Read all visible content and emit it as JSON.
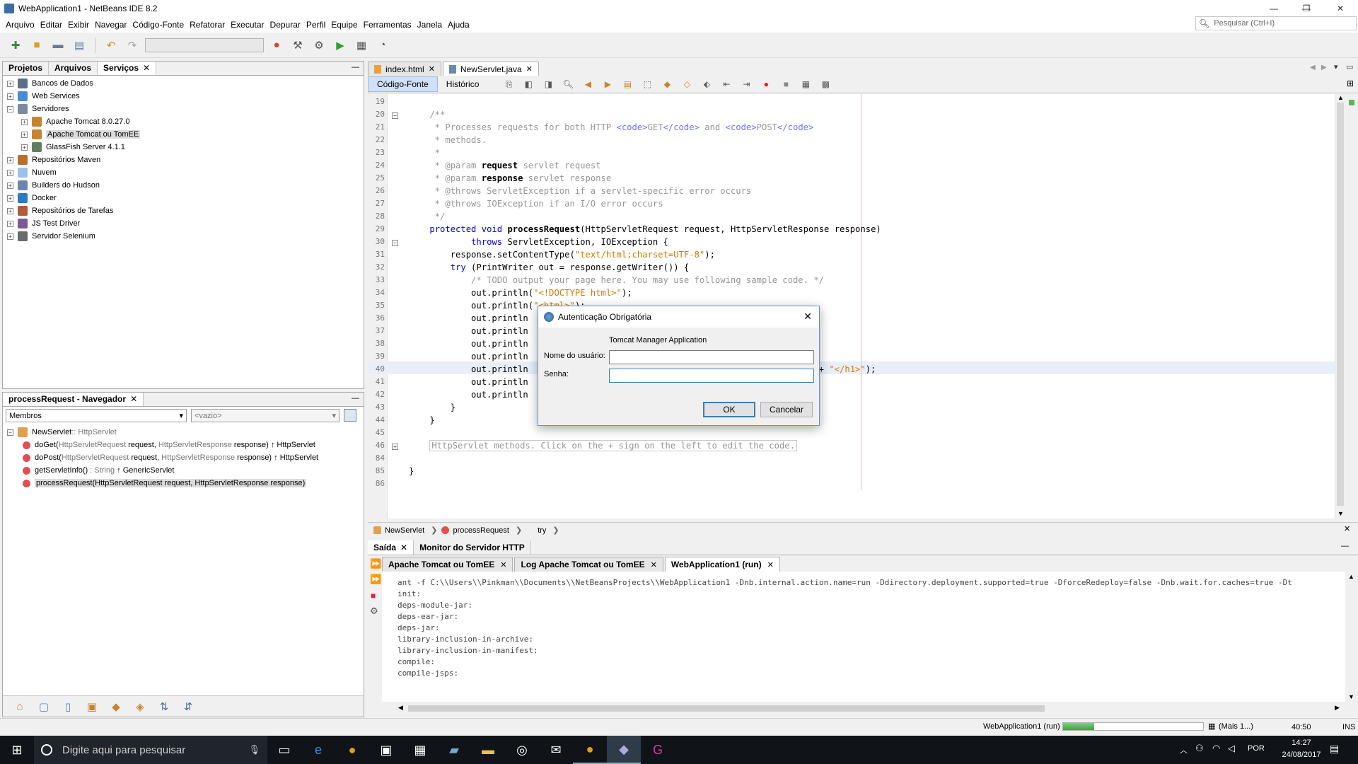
{
  "window": {
    "title": "WebApplication1 - NetBeans IDE 8.2",
    "minimize": "—",
    "maximize": "❐",
    "close": "✕"
  },
  "menu": [
    "Arquivo",
    "Editar",
    "Exibir",
    "Navegar",
    "Código-Fonte",
    "Refatorar",
    "Executar",
    "Depurar",
    "Perfil",
    "Equipe",
    "Ferramentas",
    "Janela",
    "Ajuda"
  ],
  "search": {
    "placeholder": "Pesquisar (Ctrl+I)"
  },
  "left_top": {
    "tabs": [
      "Projetos",
      "Arquivos",
      "Serviços"
    ],
    "active_tab": "Serviços",
    "minimize_label": "—",
    "tree": [
      {
        "label": "Bancos de Dados",
        "level": 0,
        "color": "#5a6e8c"
      },
      {
        "label": "Web Services",
        "level": 0,
        "color": "#4b8bd4"
      },
      {
        "label": "Servidores",
        "level": 0,
        "color": "#7a8aa0",
        "expanded": true
      },
      {
        "label": "Apache Tomcat 8.0.27.0",
        "level": 1,
        "color": "#c8842c"
      },
      {
        "label": "Apache Tomcat ou TomEE",
        "level": 1,
        "color": "#c8842c",
        "selected": true
      },
      {
        "label": "GlassFish Server 4.1.1",
        "level": 1,
        "color": "#5f7f5f"
      },
      {
        "label": "Repositórios Maven",
        "level": 0,
        "color": "#b8702a"
      },
      {
        "label": "Nuvem",
        "level": 0,
        "color": "#9cc2e8"
      },
      {
        "label": "Builders do Hudson",
        "level": 0,
        "color": "#6a86b0"
      },
      {
        "label": "Docker",
        "level": 0,
        "color": "#2e7ac2"
      },
      {
        "label": "Repositórios de Tarefas",
        "level": 0,
        "color": "#b05a3a"
      },
      {
        "label": "JS Test Driver",
        "level": 0,
        "color": "#7a5a9a"
      },
      {
        "label": "Servidor Selenium",
        "level": 0,
        "color": "#6a6a6a"
      }
    ]
  },
  "navigator": {
    "title": "processRequest - Navegador",
    "minimize_label": "—",
    "filter_left": "Membros",
    "filter_right": "<vazio>",
    "class_label": "NewServlet",
    "class_super": " :: HttpServlet",
    "members": [
      {
        "name": "doGet(",
        "params": "HttpServletRequest",
        "rest": " request, ",
        "params2": "HttpServletResponse",
        "rest2": " response) ↑ HttpServlet"
      },
      {
        "name": "doPost(",
        "params": "HttpServletRequest",
        "rest": " request, ",
        "params2": "HttpServletResponse",
        "rest2": " response) ↑ HttpServlet"
      },
      {
        "name": "getServletInfo()",
        "params": " : String",
        "rest": " ↑ GenericServlet",
        "params2": "",
        "rest2": ""
      },
      {
        "name": "processRequest(HttpServletRequest request, HttpServletResponse response)",
        "params": "",
        "rest": "",
        "params2": "",
        "rest2": "",
        "selected": true
      }
    ]
  },
  "editor": {
    "tabs": [
      {
        "label": "index.html",
        "active": false
      },
      {
        "label": "NewServlet.java",
        "active": true
      }
    ],
    "subtabs": [
      "Código-Fonte",
      "Histórico"
    ],
    "lines": [
      {
        "n": "19",
        "html": ""
      },
      {
        "n": "20",
        "html": "<span class=\"cm\">    /**</span>"
      },
      {
        "n": "21",
        "html": "<span class=\"cm\">     * Processes requests for both HTTP </span><span class=\"tag\">&lt;code&gt;</span><span class=\"cm\">GET</span><span class=\"tag\">&lt;/code&gt;</span><span class=\"cm\"> and </span><span class=\"tag\">&lt;code&gt;</span><span class=\"cm\">POST</span><span class=\"tag\">&lt;/code&gt;</span>"
      },
      {
        "n": "22",
        "html": "<span class=\"cm\">     * methods.</span>"
      },
      {
        "n": "23",
        "html": "<span class=\"cm\">     *</span>"
      },
      {
        "n": "24",
        "html": "<span class=\"cm\">     * @param </span><span class=\"bold\">request</span><span class=\"cm\"> servlet request</span>"
      },
      {
        "n": "25",
        "html": "<span class=\"cm\">     * @param </span><span class=\"bold\">response</span><span class=\"cm\"> servlet response</span>"
      },
      {
        "n": "26",
        "html": "<span class=\"cm\">     * @throws ServletException if a servlet-specific error occurs</span>"
      },
      {
        "n": "27",
        "html": "<span class=\"cm\">     * @throws IOException if an I/O error occurs</span>"
      },
      {
        "n": "28",
        "html": "<span class=\"cm\">     */</span>"
      },
      {
        "n": "29",
        "html": "    <span class=\"kw\">protected void</span> <span class=\"bold\">processRequest</span>(HttpServletRequest request, HttpServletResponse response)"
      },
      {
        "n": "30",
        "html": "            <span class=\"kw\">throws</span> ServletException, IOException {"
      },
      {
        "n": "31",
        "html": "        response.setContentType(<span class=\"str\">\"text/html;charset=UTF-8\"</span>);"
      },
      {
        "n": "32",
        "html": "        <span class=\"kw\">try</span> (PrintWriter out = response.getWriter()) {"
      },
      {
        "n": "33",
        "html": "<span class=\"cm\">            /* TODO output your page here. You may use following sample code. */</span>"
      },
      {
        "n": "34",
        "html": "            out.println(<span class=\"str\">\"&lt;!DOCTYPE html&gt;\"</span>);"
      },
      {
        "n": "35",
        "html": "            out.println(<span class=\"str\">\"&lt;html&gt;\"</span>);"
      },
      {
        "n": "36",
        "html": "            out.println"
      },
      {
        "n": "37",
        "html": "            out.println"
      },
      {
        "n": "38",
        "html": "            out.println"
      },
      {
        "n": "39",
        "html": "            out.println"
      },
      {
        "n": "40",
        "html": "            out.println                                                 Path() + <span class=\"str\">\"&lt;/h1&gt;\"</span>);"
      },
      {
        "n": "41",
        "html": "            out.println"
      },
      {
        "n": "42",
        "html": "            out.println"
      },
      {
        "n": "43",
        "html": "        }"
      },
      {
        "n": "44",
        "html": "    }"
      },
      {
        "n": "45",
        "html": ""
      },
      {
        "n": "46",
        "html": "    <span class=\"cm\" style=\"border:1px solid #c8c8c8;padding:0 2px\">HttpServlet methods. Click on the + sign on the left to edit the code.</span>"
      },
      {
        "n": "84",
        "html": ""
      },
      {
        "n": "85",
        "html": "}"
      },
      {
        "n": "86",
        "html": ""
      }
    ]
  },
  "breadcrumbs": [
    "NewServlet",
    "processRequest",
    "try"
  ],
  "output": {
    "tabs": [
      "Saída",
      "Monitor do Servidor HTTP"
    ],
    "minimize_label": "—",
    "subtabs": [
      {
        "label": "Apache Tomcat ou TomEE",
        "active": false
      },
      {
        "label": "Log Apache Tomcat ou TomEE",
        "active": false
      },
      {
        "label": "WebApplication1 (run)",
        "active": true
      }
    ],
    "lines": [
      "ant -f C:\\\\Users\\\\Pinkman\\\\Documents\\\\NetBeansProjects\\\\WebApplication1 -Dnb.internal.action.name=run -Ddirectory.deployment.supported=true -DforceRedeploy=false -Dnb.wait.for.caches=true -Dt",
      "init:",
      "deps-module-jar:",
      "deps-ear-jar:",
      "deps-jar:",
      "library-inclusion-in-archive:",
      "library-inclusion-in-manifest:",
      "compile:",
      "compile-jsps:"
    ]
  },
  "status": {
    "task": "WebApplication1 (run)",
    "more": "(Mais 1...)",
    "position": "40:50",
    "mode": "INS",
    "progress": 0.22
  },
  "dialog": {
    "title": "Autenticação Obrigatória",
    "app": "Tomcat Manager Application",
    "user_label": "Nome do usuário:",
    "user_value": "",
    "password_label": "Senha:",
    "password_value": "",
    "ok": "OK",
    "cancel": "Cancelar",
    "close": "✕"
  },
  "taskbar": {
    "search_placeholder": "Digite aqui para pesquisar",
    "lang": "POR",
    "time": "14:27",
    "date": "24/08/2017"
  }
}
